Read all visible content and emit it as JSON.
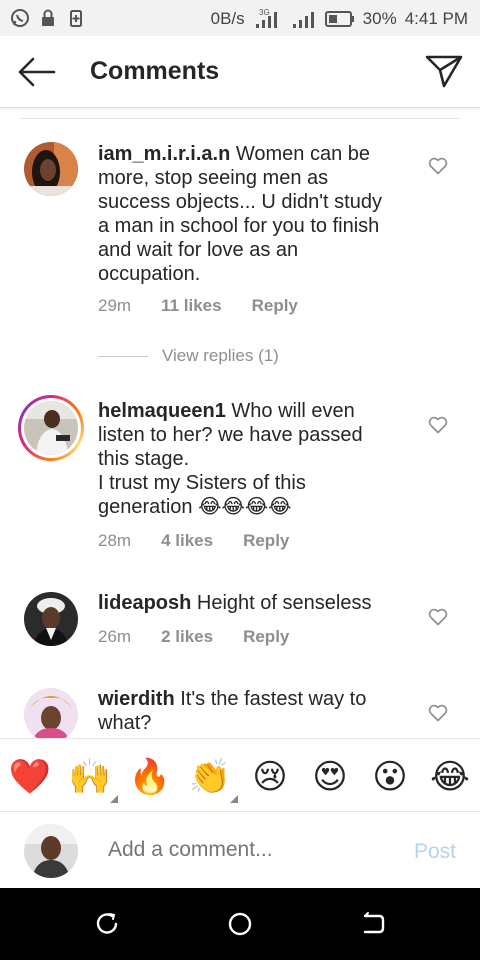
{
  "statusbar": {
    "net_speed": "0B/s",
    "network_tag": "3G",
    "battery_pct": "30%",
    "time": "4:41 PM",
    "icons": [
      "whatsapp-icon",
      "lock-icon",
      "battery-saver-icon",
      "signal-icon",
      "signal-icon",
      "battery-icon"
    ]
  },
  "header": {
    "title": "Comments",
    "back_icon": "arrow-left-icon",
    "send_icon": "paper-plane-icon"
  },
  "comments": [
    {
      "username": "iam_m.i.r.i.a.n",
      "text": "Women can be more, stop seeing men as success objects... U didn't study a man in school for you to finish and wait for love as an occupation.",
      "time": "29m",
      "likes": "11 likes",
      "reply": "Reply",
      "view_replies": "View replies (1)"
    },
    {
      "username": "helmaqueen1",
      "text": "Who will even listen to her? we have passed this stage.",
      "text2": "I trust my Sisters of this generation 😂😂😂😂",
      "time": "28m",
      "likes": "4 likes",
      "reply": "Reply"
    },
    {
      "username": "lideaposh",
      "text": "Height of senseless",
      "time": "26m",
      "likes": "2 likes",
      "reply": "Reply"
    },
    {
      "username": "wierdith",
      "text": "It's the fastest way to what?"
    }
  ],
  "emoji_bar": [
    "❤️",
    "🙌",
    "🔥",
    "👏",
    "😢",
    "😍",
    "😮",
    "😂"
  ],
  "add_comment": {
    "placeholder": "Add a comment...",
    "post_label": "Post"
  },
  "colors": {
    "link_disabled": "#b3d4f5",
    "muted": "#8e8e8e",
    "text": "#262626"
  }
}
